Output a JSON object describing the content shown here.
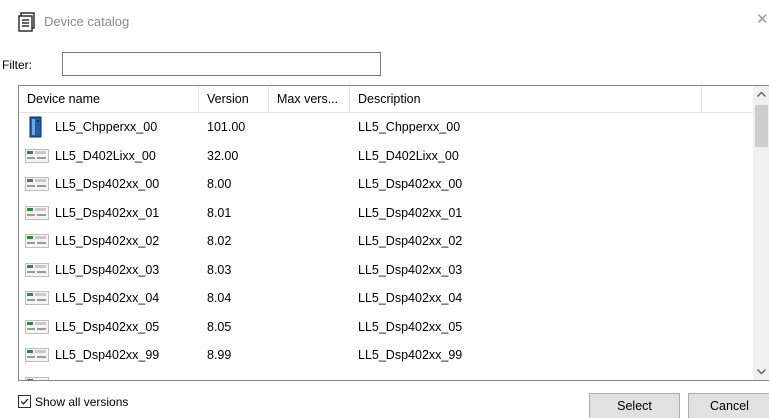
{
  "window": {
    "title": "Device catalog",
    "close_glyph": "✕"
  },
  "filter": {
    "label": "Filter:",
    "value": ""
  },
  "table": {
    "columns": [
      "Device name",
      "Version",
      "Max vers...",
      "Description"
    ],
    "rows": [
      {
        "name": "LL5_Chpperxx_00",
        "version": "101.00",
        "max_version": "",
        "description": "LL5_Chpperxx_00",
        "icon": "cpu-module-icon"
      },
      {
        "name": "LL5_D402Lixx_00",
        "version": "32.00",
        "max_version": "",
        "description": "LL5_D402Lixx_00",
        "icon": "expansion-module-icon"
      },
      {
        "name": "LL5_Dsp402xx_00",
        "version": "8.00",
        "max_version": "",
        "description": "LL5_Dsp402xx_00",
        "icon": "expansion-module-icon"
      },
      {
        "name": "LL5_Dsp402xx_01",
        "version": "8.01",
        "max_version": "",
        "description": "LL5_Dsp402xx_01",
        "icon": "expansion-module-icon"
      },
      {
        "name": "LL5_Dsp402xx_02",
        "version": "8.02",
        "max_version": "",
        "description": "LL5_Dsp402xx_02",
        "icon": "expansion-module-icon"
      },
      {
        "name": "LL5_Dsp402xx_03",
        "version": "8.03",
        "max_version": "",
        "description": "LL5_Dsp402xx_03",
        "icon": "expansion-module-icon"
      },
      {
        "name": "LL5_Dsp402xx_04",
        "version": "8.04",
        "max_version": "",
        "description": "LL5_Dsp402xx_04",
        "icon": "expansion-module-icon"
      },
      {
        "name": "LL5_Dsp402xx_05",
        "version": "8.05",
        "max_version": "",
        "description": "LL5_Dsp402xx_05",
        "icon": "expansion-module-icon"
      },
      {
        "name": "LL5_Dsp402xx_99",
        "version": "8.99",
        "max_version": "",
        "description": "LL5_Dsp402xx_99",
        "icon": "expansion-module-icon"
      }
    ]
  },
  "footer": {
    "show_all_label": "Show all versions",
    "show_all_checked": true,
    "select_label": "Select",
    "cancel_label": "Cancel"
  },
  "colors": {
    "cpu_icon_blue": "#1f5fa8",
    "module_icon_green": "#2e8b3a",
    "title_text": "#8a8a8a",
    "button_face": "#e1e1e1"
  }
}
